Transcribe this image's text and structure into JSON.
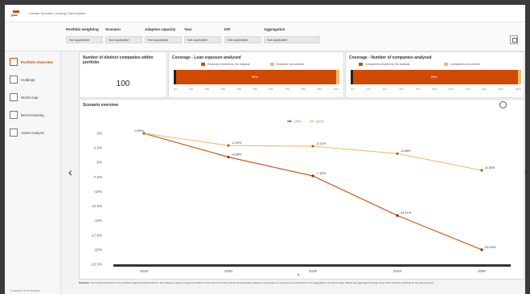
{
  "header": {
    "logo_text": "pwc",
    "app_title": "Climate Scenario Lending Commodities"
  },
  "filters": [
    {
      "label": "Portfolio weighting",
      "value": "Not applicable"
    },
    {
      "label": "Scenario",
      "value": "Not applicable"
    },
    {
      "label": "Adaptive capacity",
      "value": "Not applicable"
    },
    {
      "label": "Year",
      "value": "Not applicable"
    },
    {
      "label": "KPI",
      "value": "Not applicable"
    },
    {
      "label": "Aggregation",
      "value": "Not applicable"
    }
  ],
  "sidebar": {
    "items": [
      {
        "label": "Portfolio Overview",
        "icon": "overview-icon",
        "active": true
      },
      {
        "label": "Holdings",
        "icon": "holdings-icon",
        "active": false
      },
      {
        "label": "World map",
        "icon": "world-map-icon",
        "active": false
      },
      {
        "label": "Benchmarking",
        "icon": "benchmarking-icon",
        "active": false
      },
      {
        "label": "Asset Analysis",
        "icon": "asset-analysis-icon",
        "active": false
      }
    ],
    "bottom_text": "Company Level Analysis"
  },
  "cards": {
    "distinct": {
      "title": "Number of distinct companies within portfolio",
      "value": "100"
    },
    "loan_coverage": {
      "title": "Coverage - Loan exposure analysed",
      "legend_covered": "Exposure covered by the analysis",
      "legend_not": "Exposure not covered",
      "pct_label": "95%",
      "fraction": 0.98
    },
    "company_coverage": {
      "title": "Coverage - Number of companies analysed",
      "legend_covered": "Companies covered by the analysis",
      "legend_not": "Companies not covered",
      "pct_label": "99%",
      "fraction": 0.98
    }
  },
  "colors": {
    "accent": "#d04a02",
    "secondary": "#f4b96b",
    "dark": "#222222"
  },
  "chart_data": {
    "type": "line",
    "title": "Scenario overview",
    "categories": [
      "2025",
      "2030",
      "2035",
      "2040",
      "2050"
    ],
    "series": [
      {
        "name": "1.5°C",
        "color": "#d04a02",
        "values": [
          0.0,
          -4.08,
          -7.32,
          -14.11,
          -20.0
        ],
        "labels": [
          "0.00%",
          "-4.08%",
          "-7.32%",
          "-14.11%",
          "-20.00%"
        ]
      },
      {
        "name": "3.0°C",
        "color": "#f4b96b",
        "values": [
          0.0,
          -2.09,
          -2.21,
          -3.48,
          -6.35
        ],
        "labels": [
          "0.00%",
          "-2.09%",
          "-2.21%",
          "-3.48%",
          "-6.35%"
        ]
      }
    ],
    "ylim": [
      -22.5,
      0
    ],
    "yticks": [
      "0%",
      "-2.5%",
      "-5%",
      "-7.5%",
      "-10%",
      "-12.5%",
      "-15%",
      "-17.5%",
      "-20%",
      "-22.5%"
    ],
    "legend_position": "top-center"
  },
  "footnote": {
    "bold": "Scenario:",
    "text": "The results are based on the portfolio weighting selected above. The change in value is measured relative to the current scenario across all companies analysed. Companies not covered are excluded from the aggregation. The percentage reflects the aggregated change under each transition pathway for the selected year."
  }
}
